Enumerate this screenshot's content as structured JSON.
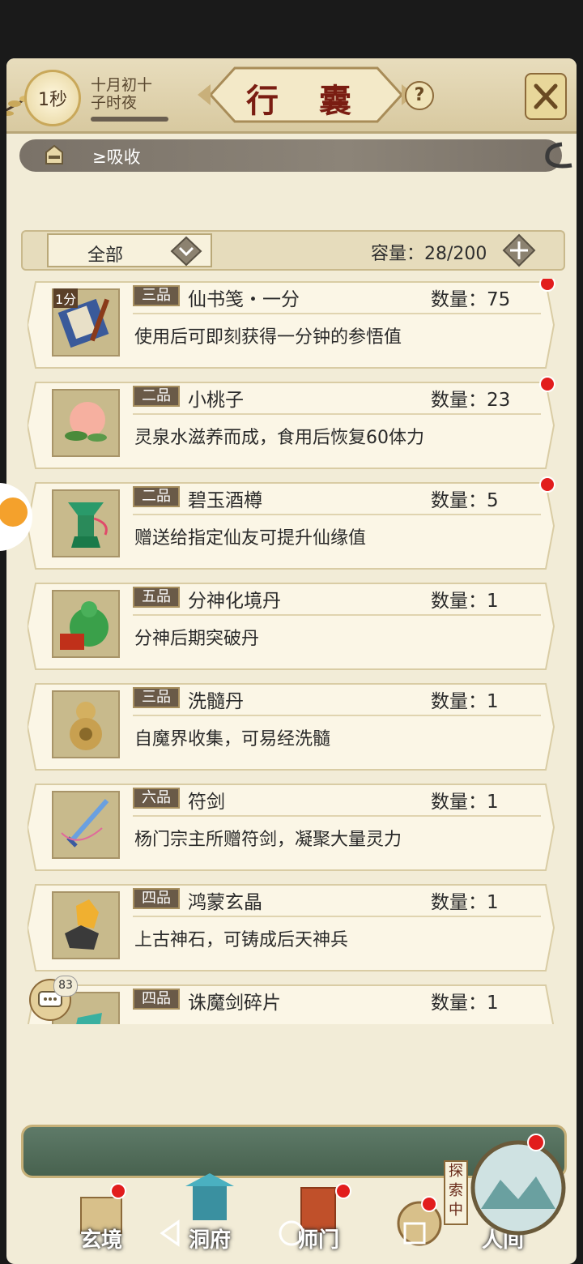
{
  "header": {
    "time_value": "1秒",
    "date_line1": "十月初十",
    "date_line2": "子时夜",
    "title": "行 囊",
    "help": "?"
  },
  "notice": {
    "text": "≥吸收"
  },
  "filter": {
    "dropdown_value": "全部",
    "capacity_label": "容量：28/200"
  },
  "items": [
    {
      "grade": "三品",
      "name": "仙书笺・一分",
      "qty": "数量：75",
      "desc": "使用后可即刻获得一分钟的参悟值",
      "tag": "1分",
      "new": true
    },
    {
      "grade": "二品",
      "name": "小桃子",
      "qty": "数量：23",
      "desc": "灵泉水滋养而成，食用后恢复60体力",
      "new": true
    },
    {
      "grade": "二品",
      "name": "碧玉酒樽",
      "qty": "数量：5",
      "desc": "赠送给指定仙友可提升仙缘值",
      "new": true
    },
    {
      "grade": "五品",
      "name": "分神化境丹",
      "qty": "数量：1",
      "desc": "分神后期突破丹",
      "new": false
    },
    {
      "grade": "三品",
      "name": "洗髓丹",
      "qty": "数量：1",
      "desc": "自魔界收集，可易经洗髓",
      "new": false
    },
    {
      "grade": "六品",
      "name": "符剑",
      "qty": "数量：1",
      "desc": "杨门宗主所赠符剑，凝聚大量灵力",
      "new": false
    },
    {
      "grade": "四品",
      "name": "鸿蒙玄晶",
      "qty": "数量：1",
      "desc": "上古神石，可铸成后天神兵",
      "new": false
    },
    {
      "grade": "四品",
      "name": "诛魔剑碎片",
      "qty": "数量：1",
      "desc": "",
      "new": false
    }
  ],
  "chat": {
    "count": "83"
  },
  "nav": {
    "xuanjing": "玄境",
    "dongfu": "洞府",
    "shimen": "师门",
    "renjian": "人间",
    "explore_badge": "探索中",
    "bag_label": "行囊"
  },
  "colors": {
    "accent_red": "#7a1d12",
    "badge_red": "#e21d1d",
    "grade_bg": "#6a5a48"
  }
}
